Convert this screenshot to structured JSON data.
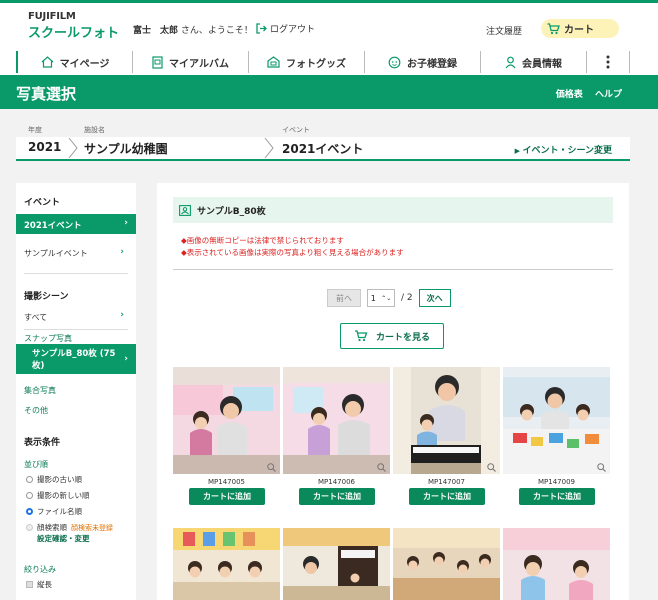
{
  "header": {
    "brand": "FUJIFILM",
    "app_name": "スクールフォト",
    "welcome_name": "富士　太郎",
    "welcome_suffix": "さん、ようこそ！",
    "logout_label": "ログアウト",
    "order_history_label": "注文履歴",
    "cart_label": "カート"
  },
  "nav": {
    "items": [
      {
        "label": "マイページ",
        "icon": "home-icon"
      },
      {
        "label": "マイアルバム",
        "icon": "album-icon"
      },
      {
        "label": "フォトグッズ",
        "icon": "goods-icon"
      },
      {
        "label": "お子様登録",
        "icon": "child-face-icon"
      },
      {
        "label": "会員情報",
        "icon": "member-icon"
      }
    ],
    "more_icon": "vertical-dots-icon"
  },
  "titlebar": {
    "title": "写真選択",
    "price_list": "価格表",
    "help": "ヘルプ"
  },
  "breadcrumb": {
    "year_label": "年度",
    "facility_label": "施設名",
    "event_label": "イベント",
    "year": "2021",
    "facility": "サンプル幼稚園",
    "event": "2021イベント",
    "change_label": "イベント・シーン変更"
  },
  "sidebar": {
    "event_heading": "イベント",
    "events": [
      "2021イベント",
      "サンプルイベント"
    ],
    "scene_heading": "撮影シーン",
    "scene_all": "すべて",
    "scene_group": "スナップ写真",
    "scene_active_line1": "サンプルB_80枚 (75",
    "scene_active_line2": "枚)",
    "scene_group_photo": "集合写真",
    "scene_other": "その他",
    "display_heading": "表示条件",
    "sort_label": "並び順",
    "sort_options": [
      "撮影の古い順",
      "撮影の新しい順",
      "ファイル名順",
      "顔検索順"
    ],
    "sort_selected": "ファイル名順",
    "face_unregistered": "顔検索未登録",
    "face_settings": "設定確認・変更",
    "filter_label": "絞り込み",
    "filter_portrait": "縦長"
  },
  "main": {
    "album_title": "サンプルB_80枚",
    "warnings": [
      "◆画像の無断コピーは法律で禁じられております",
      "◆表示されている画像は実際の写真より粗く見える場合があります"
    ],
    "pager": {
      "prev_label": "前へ",
      "current_page": "1",
      "total": "/ 2",
      "next_label": "次へ"
    },
    "view_cart_label": "カートを見る",
    "add_to_cart_label": "カートに追加",
    "photos": [
      {
        "code": "MP147005"
      },
      {
        "code": "MP147006"
      },
      {
        "code": "MP147007"
      },
      {
        "code": "MP147009"
      }
    ]
  },
  "colors": {
    "brand_green": "#0a9a6a",
    "button_green": "#0a8a5a",
    "cart_yellow": "#fdf3b8",
    "warning_red": "#dd2222"
  }
}
